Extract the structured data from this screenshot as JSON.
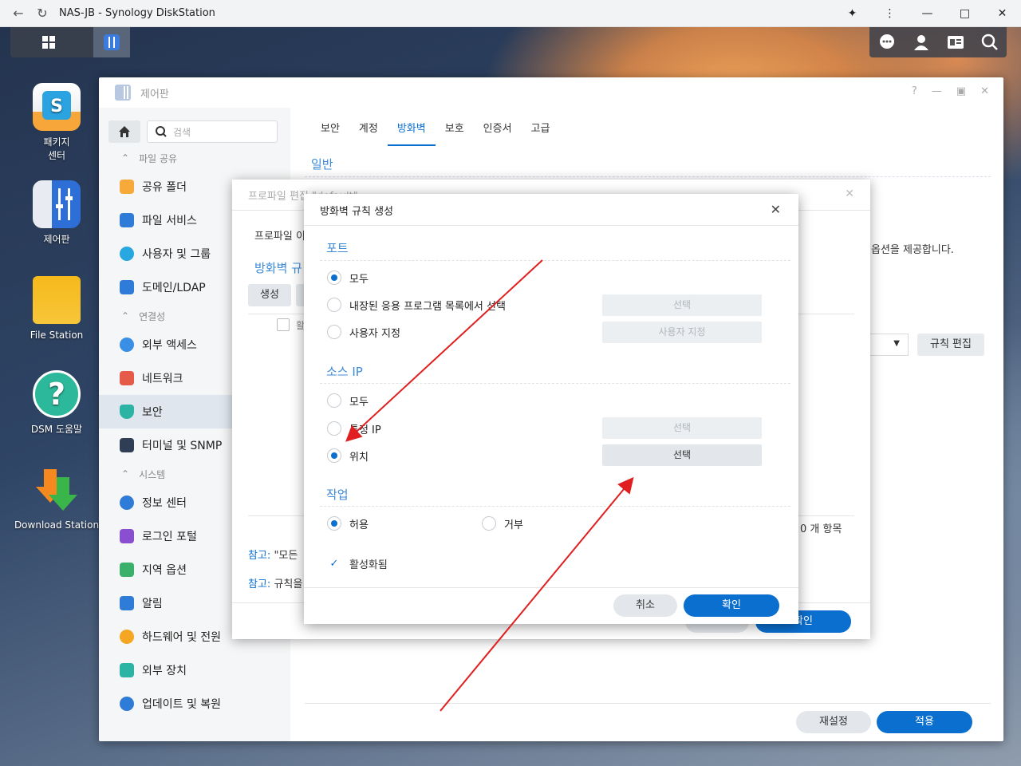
{
  "browser": {
    "title": "NAS-JB - Synology DiskStation"
  },
  "desktop": {
    "icons": [
      {
        "label_1": "패키지",
        "label_2": "센터"
      },
      {
        "label_1": "제어판"
      },
      {
        "label_1": "File Station"
      },
      {
        "label_1": "DSM 도움말"
      },
      {
        "label_1": "Download Station"
      }
    ]
  },
  "control_panel": {
    "title": "제어판",
    "search_placeholder": "검색",
    "sections": {
      "file_sharing": "파일 공유",
      "connectivity": "연결성",
      "system": "시스템"
    },
    "items": {
      "shared_folder": "공유 폴더",
      "file_services": "파일 서비스",
      "users_groups": "사용자 및 그룹",
      "domain_ldap": "도메인/LDAP",
      "external_access": "외부 액세스",
      "network": "네트워크",
      "security": "보안",
      "terminal_snmp": "터미널 및 SNMP",
      "info_center": "정보 센터",
      "login_portal": "로그인 포털",
      "regional_options": "지역 옵션",
      "notification": "알림",
      "hardware_power": "하드웨어 및 전원",
      "external_devices": "외부 장치",
      "update_restore": "업데이트 및 복원"
    },
    "tabs": [
      "보안",
      "계정",
      "방화벽",
      "보호",
      "인증서",
      "고급"
    ],
    "active_tab": "방화벽",
    "section_heading": "일반",
    "desc_partial": "옵션을 제공합니다.",
    "rule_edit_button": "규칙 편집",
    "reset_button": "재설정",
    "apply_button": "적용"
  },
  "profile_dialog": {
    "title": "프로파일 편집 \"default\"",
    "profile_label": "프로파일 이",
    "subheading": "방화벽 규",
    "create_button": "생성",
    "col_partial": "활",
    "item_count": "0 개 항목",
    "note1_prefix": "참고:",
    "note1_text": "\"모든",
    "note2_prefix": "참고:",
    "note2_text": "규칙을",
    "ok_button": "확인"
  },
  "rule_dialog": {
    "title": "방화벽 규칙 생성",
    "port": {
      "heading": "포트",
      "options": [
        "모두",
        "내장된 응용 프로그램 목록에서 선택",
        "사용자 지정"
      ],
      "selected": 0,
      "select_button": "선택",
      "custom_button": "사용자 지정"
    },
    "source_ip": {
      "heading": "소스 IP",
      "options": [
        "모두",
        "특정 IP",
        "위치"
      ],
      "selected": 2,
      "specific_button": "선택",
      "location_button": "선택"
    },
    "action": {
      "heading": "작업",
      "allow": "허용",
      "deny": "거부",
      "selected": "allow"
    },
    "enabled": {
      "label": "활성화됨",
      "checked": true
    },
    "cancel_button": "취소",
    "ok_button": "확인"
  }
}
